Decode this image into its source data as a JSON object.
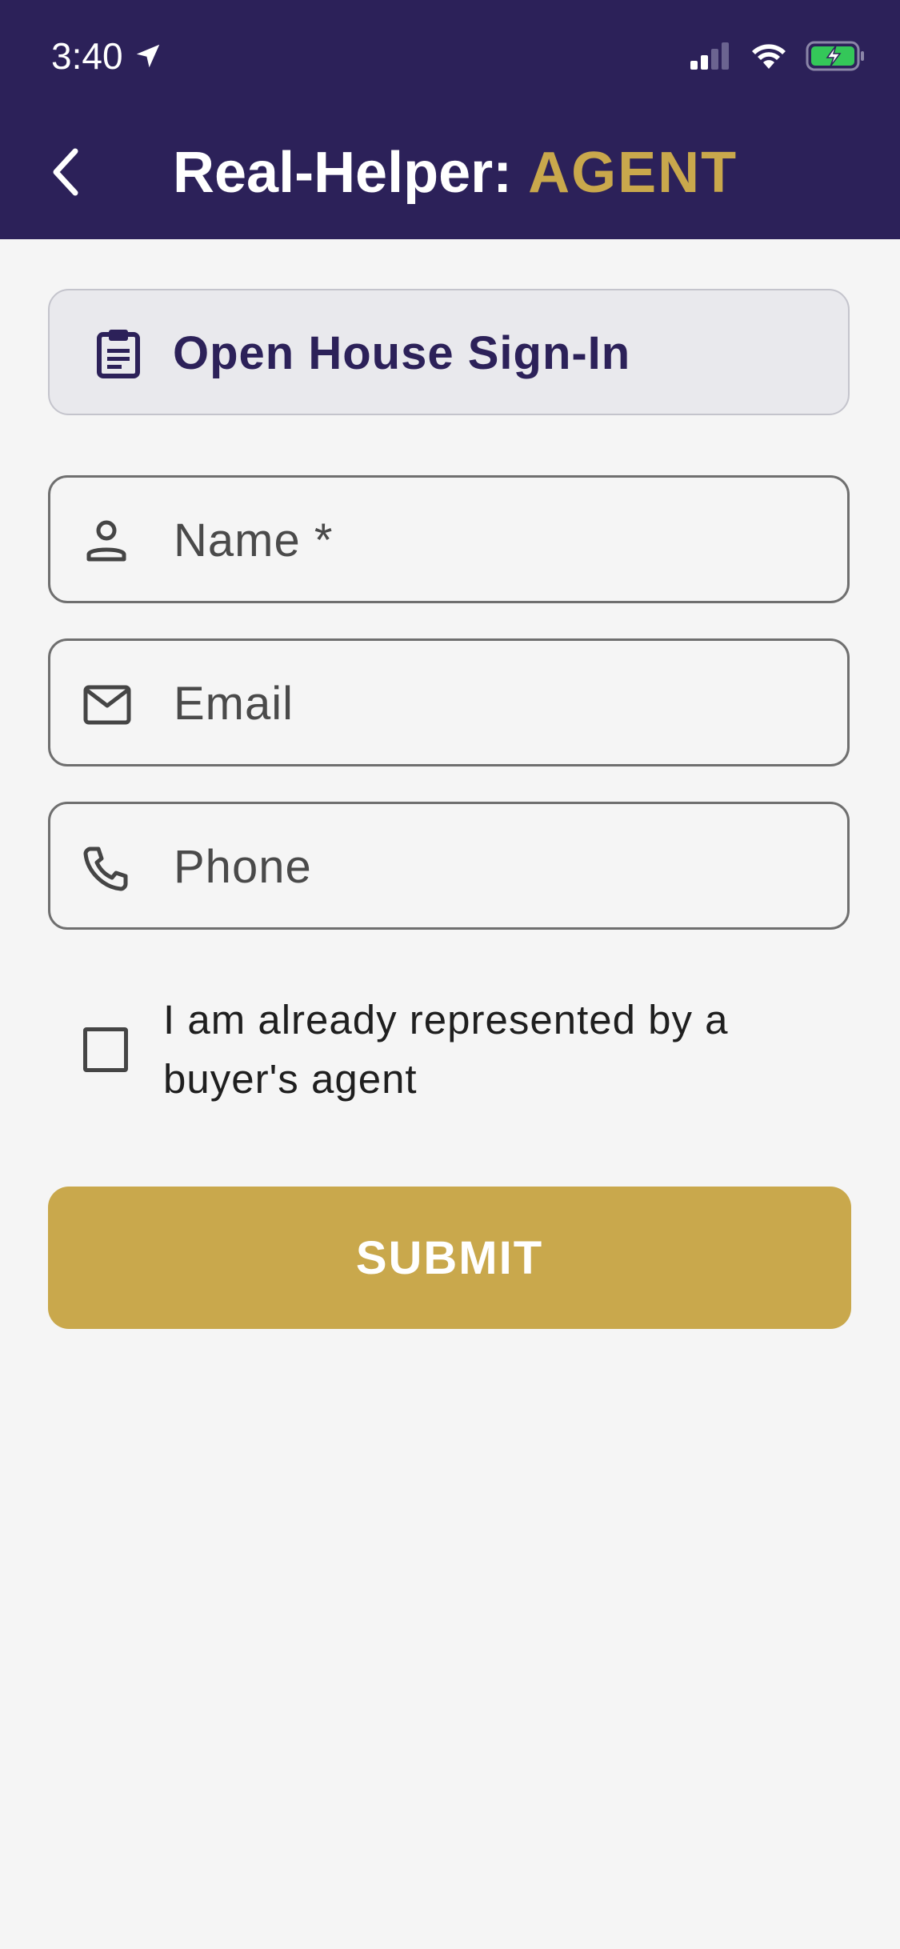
{
  "status_bar": {
    "time": "3:40",
    "icons": [
      "location-arrow-icon",
      "cellular-signal-icon",
      "wifi-icon",
      "battery-charging-icon"
    ]
  },
  "nav": {
    "title_main": "Real-Helper: ",
    "title_accent": "AGENT",
    "back_icon": "chevron-left-icon"
  },
  "banner": {
    "icon": "clipboard-icon",
    "label": "Open House Sign-In"
  },
  "form": {
    "name": {
      "placeholder": "Name *",
      "value": "",
      "icon": "person-icon"
    },
    "email": {
      "placeholder": "Email",
      "value": "",
      "icon": "mail-icon"
    },
    "phone": {
      "placeholder": "Phone",
      "value": "",
      "icon": "phone-icon"
    },
    "represented": {
      "label": "I am already represented by a buyer's agent",
      "checked": false
    },
    "submit_label": "SUBMIT"
  },
  "colors": {
    "header_bg": "#2c2159",
    "accent": "#c9a84c",
    "page_bg": "#f5f5f5",
    "banner_bg": "#e9e9ed",
    "battery_green": "#34c759"
  }
}
